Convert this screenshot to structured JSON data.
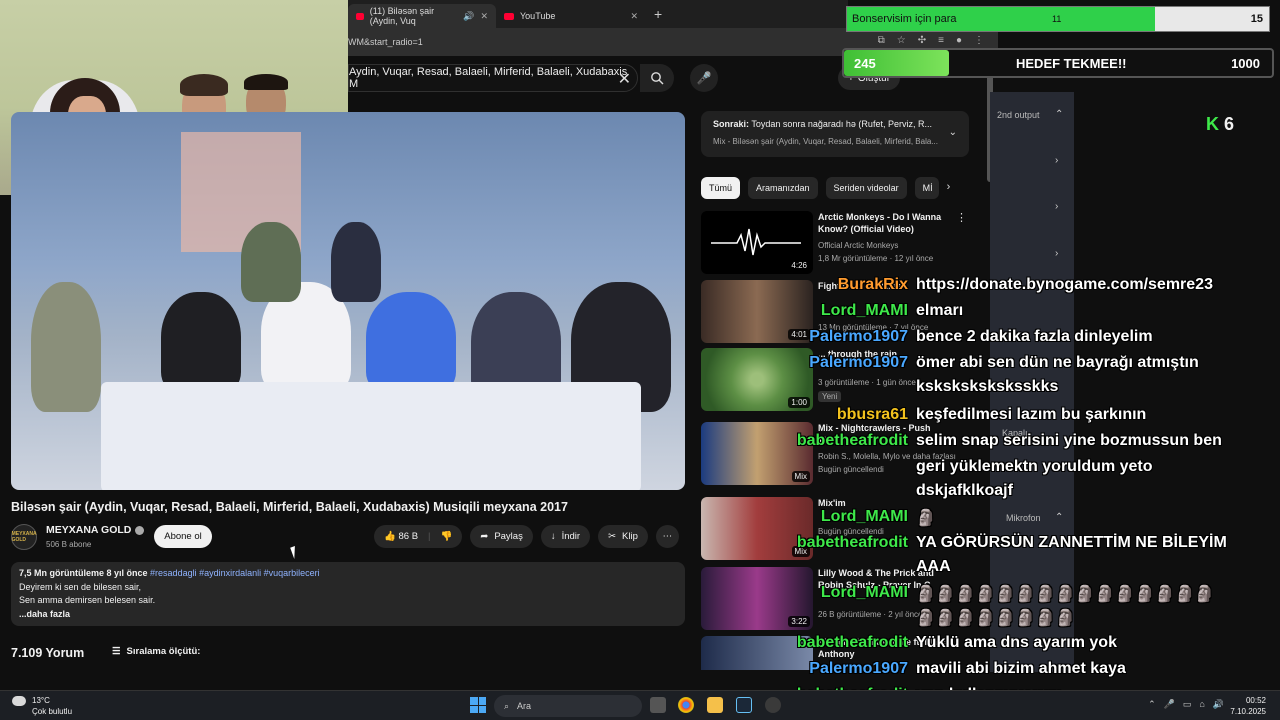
{
  "browser": {
    "tabs": [
      {
        "title": "(11) Biləsən şair (Aydin, Vuqar, Resad, Balaeli, Mirferid, Balaeli, Xudabaxis) Musiqili meyxana 2017",
        "short": "(11) Biləsən şair (Aydin, Vuq"
      },
      {
        "title": "YouTube",
        "short": "YouTube"
      }
    ],
    "url": "WM&start_radio=1"
  },
  "youtube": {
    "search_value": "Aydin, Vuqar, Resad, Balaeli, Mirferid, Balaeli, Xudabaxis M",
    "create_label": "Oluştur",
    "video": {
      "title": "Biləsən şair (Aydin, Vuqar, Resad, Balaeli, Mirferid, Balaeli, Xudabaxis) Musiqili meyxana 2017",
      "channel": "MEYXANA GOLD",
      "channel_logo_text": "MEYXANA GOLD",
      "subscribers": "506 B abone",
      "subscribe_label": "Abone ol",
      "likes": "86 B",
      "share": "Paylaş",
      "download": "İndir",
      "clip": "Klip",
      "views_line": "7,5 Mn görüntüleme  8 yıl önce",
      "hashtags": "#resaddagli #aydinxirdalanli #vuqarbileceri",
      "desc_lines": [
        "Deyirem ki sen de bilesen sair,",
        "Sen amma demirsen belesen sair."
      ],
      "more": "...daha fazla",
      "comments": "7.109 Yorum",
      "sort": "Sıralama ölçütü:"
    },
    "up_next": {
      "label": "Sonraki:",
      "title": "Toydan sonra nağaradı hə (Rufet, Perviz, R...",
      "subtitle": "Mix - Biləsən şair (Aydin, Vuqar, Resad, Balaeli, Mirferid, Bala..."
    },
    "chips": [
      "Tümü",
      "Aramanızdan",
      "Seriden videolar",
      "Mİ"
    ],
    "recommendations": [
      {
        "title": "Arctic Monkeys - Do I Wanna Know? (Official Video)",
        "channel": "Official Arctic Monkeys",
        "meta": "1,8 Mr görüntüleme · 12 yıl önce",
        "duration": "4:26"
      },
      {
        "title": "Fight Club ... Pixies",
        "channel": "",
        "meta": "13 Mn görüntüleme · 7 yıl önce",
        "duration": "4:01"
      },
      {
        "title": "... through the rain",
        "channel": "",
        "meta": "3 görüntüleme · 1 gün önce",
        "badge": "Yeni",
        "duration": "1:00"
      },
      {
        "title": "Mix - Nightcrawlers - Push The ...",
        "channel": "Robin S., Molella, Mylo ve daha fazlası",
        "meta": "Bugün güncellendi",
        "duration": "Mix"
      },
      {
        "title": "Mix'im",
        "channel": "... ve da...",
        "meta": "Bugün güncellendi",
        "duration": "Mix"
      },
      {
        "title": "Lilly Wood & The Prick and Robin Schulz - Prayer In C",
        "channel": "",
        "meta": "26 B görüntüleme · 2 yıl önce",
        "duration": "3:22"
      },
      {
        "title": "Pitbull - Rain Over Me ft. Marc Anthony",
        "channel": "",
        "meta": "",
        "duration": ""
      }
    ]
  },
  "overlay": {
    "goal": {
      "title": "Bonservisim için para",
      "current": "11",
      "max": "15",
      "progress": 0.73
    },
    "hedef": {
      "current": "245",
      "label": "HEDEF TEKMEE!!",
      "max": "1000",
      "progress": 0.245
    },
    "k_label": "K",
    "k_count": "6",
    "panel_labels": {
      "output": "2nd output",
      "kapali": "Kapalı",
      "mikrofon": "Mikrofon"
    },
    "chat": [
      {
        "user": "BurakRix",
        "color": "#ff9b2e",
        "text": "https://donate.bynogame.com/semre23"
      },
      {
        "user": "Lord_MAMI",
        "color": "#3ee84a",
        "text": "elmarı"
      },
      {
        "user": "Palermo1907",
        "color": "#4aa8ff",
        "text": "bence 2 dakika fazla dinleyelim"
      },
      {
        "user": "Palermo1907",
        "color": "#4aa8ff",
        "text": "ömer abi sen dün ne bayrağı atmıştın"
      },
      {
        "user": "",
        "color": "#ffffff",
        "text": "ksksksksksksskks"
      },
      {
        "user": "bbusra61",
        "color": "#f2c21d",
        "text": "keşfedilmesi lazım bu şarkının"
      },
      {
        "user": "babetheafrodit",
        "color": "#3ee84a",
        "text": "selim snap serisini yine bozmussun ben"
      },
      {
        "user": "",
        "color": "#ffffff",
        "text": "geri yüklemektn yoruldum yeto"
      },
      {
        "user": "",
        "color": "#ffffff",
        "text": "dskjafklkoajf"
      },
      {
        "user": "Lord_MAMI",
        "color": "#3ee84a",
        "text": "🗿"
      },
      {
        "user": "babetheafrodit",
        "color": "#3ee84a",
        "text": "YA GÖRÜRSÜN ZANNETTİM NE BİLEYİM"
      },
      {
        "user": "",
        "color": "#ffffff",
        "text": "AAA"
      },
      {
        "user": "Lord_MAMI",
        "color": "#3ee84a",
        "text": "🗿🗿🗿🗿🗿🗿🗿🗿🗿🗿🗿🗿🗿🗿🗿"
      },
      {
        "user": "",
        "color": "#ffffff",
        "text": "🗿🗿🗿🗿🗿🗿🗿🗿"
      },
      {
        "user": "babetheafrodit",
        "color": "#3ee84a",
        "text": "Yüklü ama dns ayarım yok"
      },
      {
        "user": "Palermo1907",
        "color": "#4aa8ff",
        "text": "mavili abi bizim ahmet kaya"
      },
      {
        "user": "babetheafrodit",
        "color": "#3ee84a",
        "text": "vpn kullanmıyorum"
      }
    ]
  },
  "taskbar": {
    "temp": "13°C",
    "weather": "Çok bulutlu",
    "search": "Ara",
    "time": "00:52",
    "date": "7.10.2025"
  }
}
